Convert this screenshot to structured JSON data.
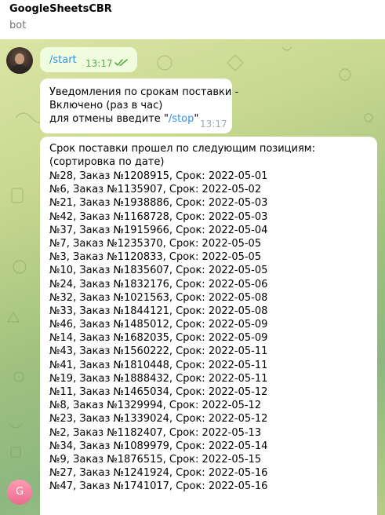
{
  "header": {
    "title": "GoogleSheetsCBR",
    "subtitle": "bot"
  },
  "messages": {
    "outgoing": {
      "command": "/start",
      "time": "13:17"
    },
    "notice": {
      "line1": "Уведомления по срокам поставки -",
      "line2": "Включено (раз в час)",
      "line3_prefix": "для отмены введите \"",
      "line3_command": "/stop",
      "line3_suffix": "\"",
      "time": "13:17"
    },
    "report": {
      "intro": "Срок поставки прошел по следующим позициям: (сортировка по дате)",
      "items": [
        "№28, Заказ №1208915, Срок: 2022-05-01",
        "№6, Заказ №1135907, Срок: 2022-05-02",
        "№21, Заказ №1938886, Срок: 2022-05-03",
        "№42, Заказ №1168728, Срок: 2022-05-03",
        "№37, Заказ №1915966, Срок: 2022-05-04",
        "№7, Заказ №1235370, Срок: 2022-05-05",
        "№3, Заказ №1120833, Срок: 2022-05-05",
        "№10, Заказ №1835607, Срок: 2022-05-05",
        "№24, Заказ №1832176, Срок: 2022-05-06",
        "№32, Заказ №1021563, Срок: 2022-05-08",
        "№33, Заказ №1844121, Срок: 2022-05-08",
        "№46, Заказ №1485012, Срок: 2022-05-09",
        "№14, Заказ №1682035, Срок: 2022-05-09",
        "№43, Заказ №1560222, Срок: 2022-05-11",
        "№41, Заказ №1810448, Срок: 2022-05-11",
        "№19, Заказ №1888432, Срок: 2022-05-11",
        "№11, Заказ №1465034, Срок: 2022-05-12",
        "№8, Заказ №1329994, Срок: 2022-05-12",
        "№23, Заказ №1339024, Срок: 2022-05-12",
        "№2, Заказ №1182407, Срок: 2022-05-13",
        "№34, Заказ №1089979, Срок: 2022-05-14",
        "№9, Заказ №1876515, Срок: 2022-05-15",
        "№27, Заказ №1241924, Срок: 2022-05-16",
        "№47, Заказ №1741017, Срок: 2022-05-16"
      ]
    }
  },
  "bot_avatar": {
    "letter": "G"
  },
  "colors": {
    "link": "#3390ec",
    "outgoing_bubble": "#effdde",
    "outgoing_time": "#5ca853",
    "incoming_time": "#a1aab3",
    "bot_avatar": "#e96c8e"
  },
  "icons": {
    "read_status": "double-check-icon"
  }
}
